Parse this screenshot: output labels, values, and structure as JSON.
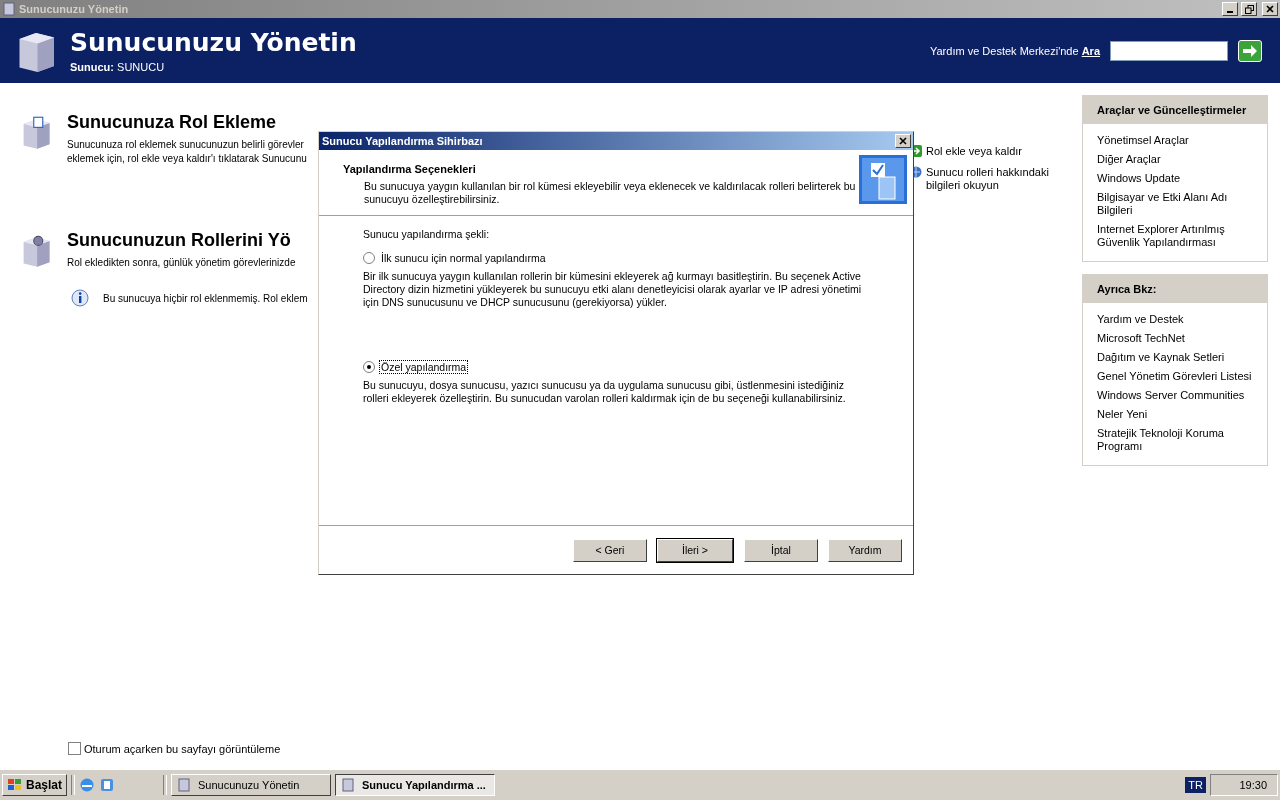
{
  "window": {
    "title": "Sunucunuzu Yönetin"
  },
  "header": {
    "title": "Sunucunuzu Yönetin",
    "server_label": "Sunucu:",
    "server_name": "SUNUCU",
    "search_label": "Yardım ve Destek Merkezi'nde",
    "search_action": "Ara"
  },
  "sections": [
    {
      "title": "Sunucunuza Rol Ekleme",
      "lines": [
        "Sunucunuza rol eklemek sunucunuzun belirli görevler",
        "eklemek için, rol ekle veya kaldır'ı tıklatarak Sunucunu"
      ],
      "links": [
        "Rol ekle veya kaldır",
        "Sunucu rolleri hakkındaki bilgileri okuyun"
      ]
    },
    {
      "title": "Sunucunuzun Rollerini Yö",
      "lines": [
        "Rol ekledikten sonra, günlük yönetim görevlerinizde"
      ],
      "info": "Bu sunucuya hiçbir rol eklenmemiş. Rol eklem"
    }
  ],
  "sidebar": [
    {
      "title": "Araçlar ve Güncelleştirmeler",
      "items": [
        "Yönetimsel Araçlar",
        "Diğer Araçlar",
        "Windows Update",
        "Bilgisayar ve Etki Alanı Adı Bilgileri",
        "Internet Explorer Artırılmış Güvenlik Yapılandırması"
      ]
    },
    {
      "title": "Ayrıca Bkz:",
      "items": [
        "Yardım ve Destek",
        "Microsoft TechNet",
        "Dağıtım ve Kaynak Setleri",
        "Genel Yönetim Görevleri Listesi",
        "Windows Server Communities",
        "Neler Yeni",
        "Stratejik Teknoloji Koruma Programı"
      ]
    }
  ],
  "startup_checkbox": {
    "label": "Oturum açarken bu sayfayı görüntüleme",
    "checked": false
  },
  "dialog": {
    "title": "Sunucu Yapılandırma Sihirbazı",
    "heading": "Yapılandırma Seçenekleri",
    "description": "Bu sunucuya yaygın kullanılan bir rol kümesi ekleyebilir veya eklenecek ve kaldırılacak rolleri belirterek bu sunucuyu özelleştirebilirsiniz.",
    "prompt": "Sunucu yapılandırma şekli:",
    "options": [
      {
        "label": "İlk sunucu için normal yapılandırma",
        "selected": false,
        "description": "Bir ilk sunucuya yaygın kullanılan rollerin bir kümesini ekleyerek ağ kurmayı basitleştirin. Bu seçenek Active Directory dizin hizmetini yükleyerek bu sunucuyu etki alanı denetleyicisi olarak ayarlar ve IP adresi yönetimi için DNS sunucusunu ve DHCP sunucusunu (gerekiyorsa) yükler."
      },
      {
        "label": "Özel yapılandırma",
        "selected": true,
        "description": "Bu sunucuyu, dosya sunucusu, yazıcı sunucusu ya da uygulama sunucusu gibi, üstlenmesini istediğiniz rolleri ekleyerek özelleştirin. Bu sunucudan varolan rolleri kaldırmak için de bu seçeneği kullanabilirsiniz."
      }
    ],
    "buttons": [
      {
        "label": "< Geri",
        "default": false
      },
      {
        "label": "İleri >",
        "default": true
      },
      {
        "label": "İptal",
        "default": false
      },
      {
        "label": "Yardım",
        "default": false
      }
    ]
  },
  "taskbar": {
    "start": "Başlat",
    "tasks": [
      {
        "label": "Sunucunuzu Yönetin",
        "selected": false
      },
      {
        "label": "Sunucu Yapılandırma ...",
        "selected": true
      }
    ],
    "language": "TR",
    "clock": "19:30"
  }
}
